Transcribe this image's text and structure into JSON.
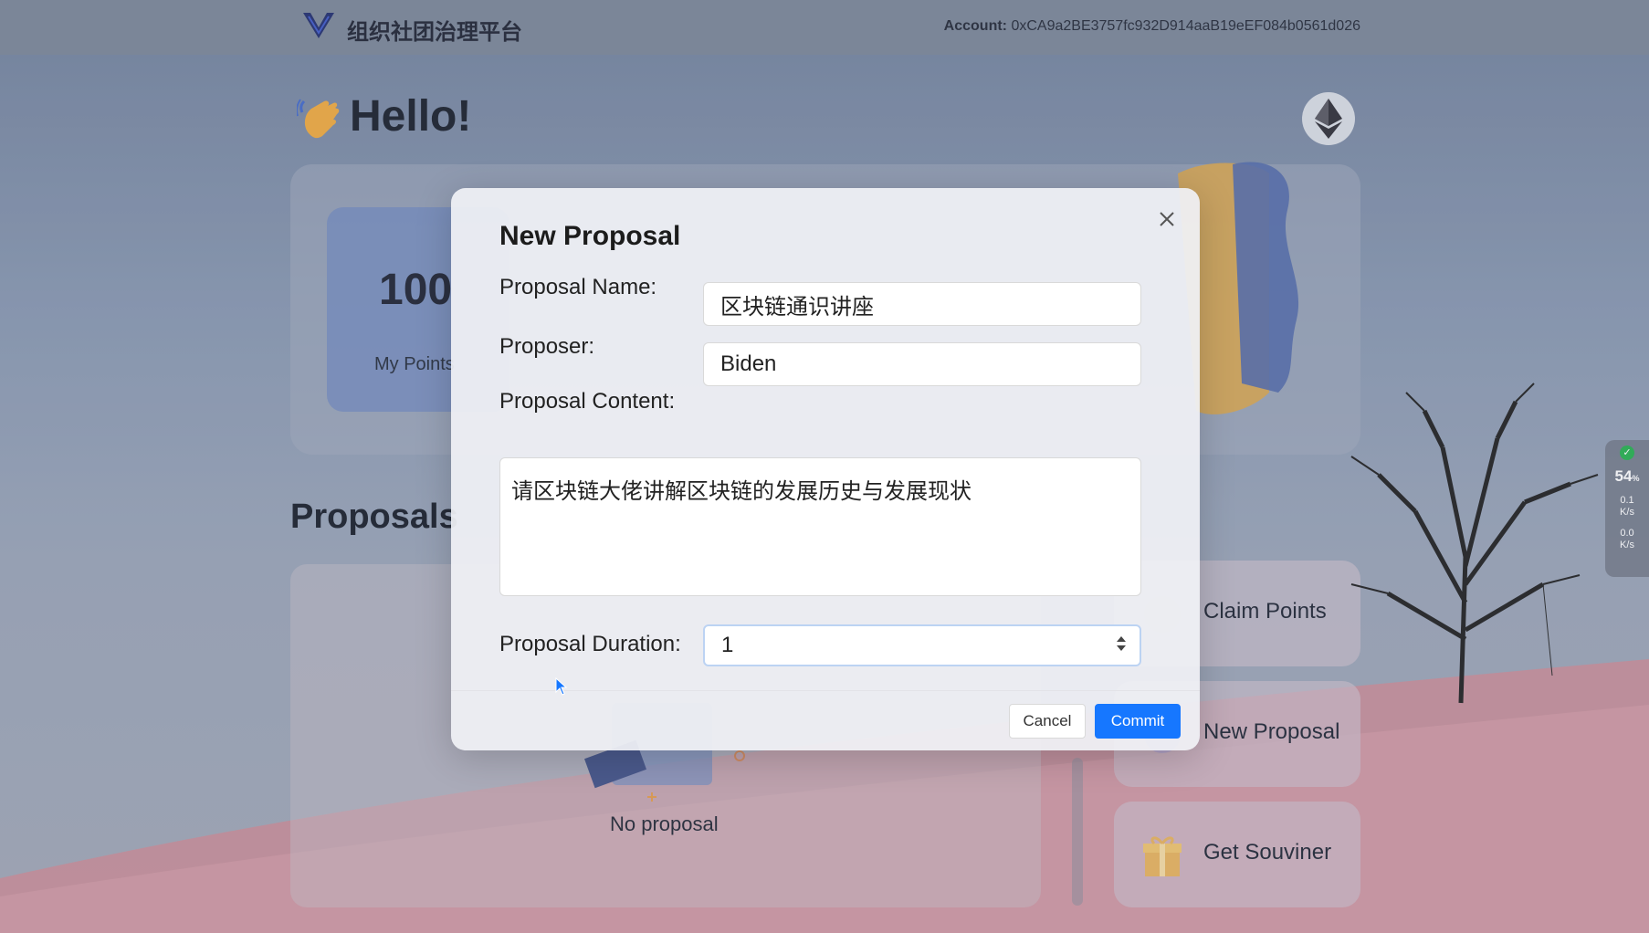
{
  "header": {
    "brand": "组织社团治理平台",
    "account_label": "Account:",
    "account_address": "0xCA9a2BE3757fc932D914aaB19eEF084b0561d026"
  },
  "page": {
    "greeting": "Hello!",
    "points_value": "100",
    "points_label": "My Points",
    "proposals_title": "Proposals",
    "empty_text": "No proposal"
  },
  "actions": [
    {
      "label": "Claim Points",
      "icon": "coin-icon"
    },
    {
      "label": "New Proposal",
      "icon": "plus-icon"
    },
    {
      "label": "Get Souviner",
      "icon": "gift-icon"
    }
  ],
  "speed_widget": {
    "percent": "54",
    "percent_unit": "%",
    "upload": "0.1",
    "upload_unit": "K/s",
    "download": "0.0",
    "download_unit": "K/s"
  },
  "modal": {
    "title": "New Proposal",
    "name_label": "Proposal Name:",
    "name_value": "区块链通识讲座",
    "proposer_label": "Proposer:",
    "proposer_value": "Biden",
    "content_label": "Proposal Content:",
    "content_value": "请区块链大佬讲解区块链的发展历史与发展现状",
    "duration_label": "Proposal Duration:",
    "duration_value": "1",
    "cancel_label": "Cancel",
    "commit_label": "Commit"
  },
  "colors": {
    "primary": "#1677ff",
    "hill": "#c98c97"
  }
}
